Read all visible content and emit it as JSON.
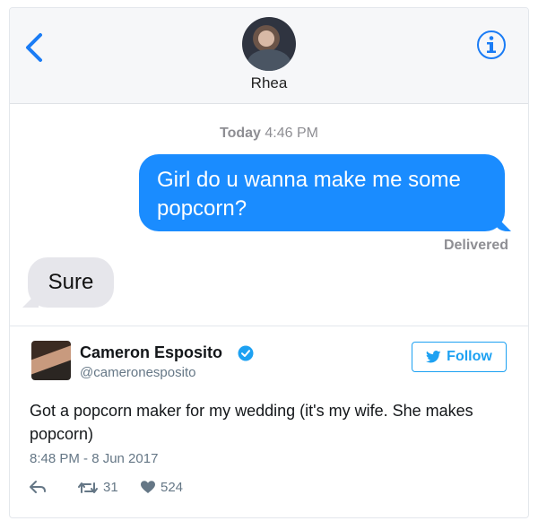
{
  "header": {
    "contact_name": "Rhea",
    "back_icon": "chevron-left-icon",
    "info_icon": "info-icon"
  },
  "conversation": {
    "timestamp_day": "Today",
    "timestamp_time": "4:46 PM",
    "outgoing_message": "Girl do u wanna make me some popcorn?",
    "delivery_status": "Delivered",
    "incoming_message": "Sure"
  },
  "tweet": {
    "author_name": "Cameron Esposito",
    "handle": "@cameronesposito",
    "follow_label": "Follow",
    "text": "Got a popcorn maker for my wedding (it's my wife. She makes popcorn)",
    "timestamp": "8:48 PM - 8 Jun 2017",
    "retweets": "31",
    "likes": "524"
  },
  "colors": {
    "imessage_blue": "#1a8cff",
    "ios_tint": "#1a7cf5",
    "twitter_blue": "#1da1f2",
    "incoming_bubble": "#e6e6eb"
  }
}
